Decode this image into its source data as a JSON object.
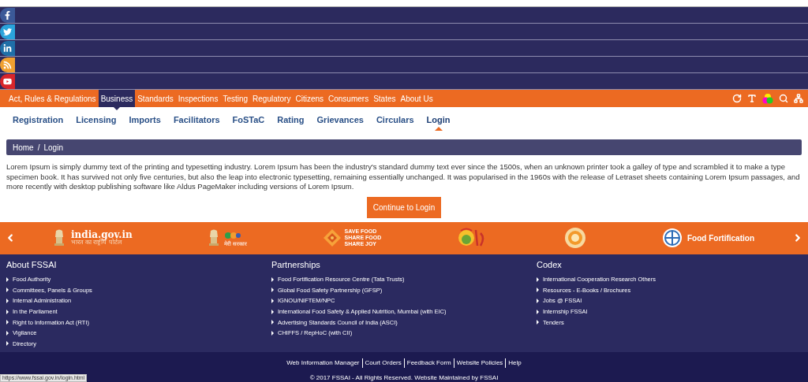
{
  "social_links": [
    {
      "kind": "facebook"
    },
    {
      "kind": "twitter"
    },
    {
      "kind": "linkedin"
    },
    {
      "kind": "rss"
    },
    {
      "kind": "youtube"
    }
  ],
  "main_nav": [
    {
      "label": "Act, Rules & Regulations",
      "selected": false
    },
    {
      "label": "Business",
      "selected": true
    },
    {
      "label": "Standards",
      "selected": false
    },
    {
      "label": "Inspections",
      "selected": false
    },
    {
      "label": "Testing",
      "selected": false
    },
    {
      "label": "Regulatory",
      "selected": false
    },
    {
      "label": "Citizens",
      "selected": false
    },
    {
      "label": "Consumers",
      "selected": false
    },
    {
      "label": "States",
      "selected": false
    },
    {
      "label": "About Us",
      "selected": false
    }
  ],
  "tools": [
    {
      "kind": "refresh"
    },
    {
      "kind": "text-size"
    },
    {
      "kind": "contrast"
    },
    {
      "kind": "search"
    },
    {
      "kind": "sitemap"
    }
  ],
  "sub_nav": [
    {
      "label": "Registration",
      "selected": false
    },
    {
      "label": "Licensing",
      "selected": false
    },
    {
      "label": "Imports",
      "selected": false
    },
    {
      "label": "Facilitators",
      "selected": false
    },
    {
      "label": "FoSTaC",
      "selected": false
    },
    {
      "label": "Rating",
      "selected": false
    },
    {
      "label": "Grievances",
      "selected": false
    },
    {
      "label": "Circulars",
      "selected": false
    },
    {
      "label": "Login",
      "selected": true
    }
  ],
  "breadcrumb": [
    "Home",
    "/",
    "Login"
  ],
  "intro": "Lorem Ipsum is simply dummy text of the printing and typesetting industry. Lorem Ipsum has been the industry's standard dummy text ever since the 1500s, when an unknown printer took a galley of type and scrambled it to make a type specimen book. It has survived not only five centuries, but also the leap into electronic typesetting, remaining essentially unchanged. It was popularised in the 1960s with the release of Letraset sheets containing Lorem Ipsum passages, and more recently with desktop publishing software like Aldus PageMaker including versions of Lorem Ipsum.",
  "continue_button": "Continue to Login",
  "carousel": [
    {
      "kind": "india-portal",
      "title": "india.gov.in",
      "subtitle": "भारत का राष्ट्रीय पोर्टल"
    },
    {
      "kind": "mygov",
      "subtitle": "मेरी सरकार"
    },
    {
      "kind": "save-food",
      "lines": [
        "SAVE FOOD",
        "SHARE FOOD",
        "SHARE JOY"
      ]
    },
    {
      "kind": "diet"
    },
    {
      "kind": "seal"
    },
    {
      "kind": "fortification",
      "title": "Food Fortification"
    }
  ],
  "footer_columns": [
    {
      "heading": "About FSSAI",
      "links": [
        "Food Authority",
        "Committees, Panels & Groups",
        "Internal Administration",
        "In the Parliament",
        "Right to Information Act (RTI)",
        "Vigilance",
        "Directory"
      ]
    },
    {
      "heading": "Partnerships",
      "links": [
        "Food Fortification Resource Centre (Tata Trusts)",
        "Global Food Safety Partnership (GFSP)",
        "IGNOU/NIFTEM/NPC",
        "International Food Safety & Applied Nutrition, Mumbai (with EIC)",
        "Advertising Standards Council of India (ASCI)",
        "CHIFFS / RepHoC (with CII)"
      ]
    },
    {
      "heading": "Codex",
      "links": [
        "International Cooperation Research Others",
        "Resources - E-Books / Brochures",
        "Jobs @ FSSAI",
        "Internship FSSAI",
        "Tenders"
      ]
    }
  ],
  "bottom_links": [
    "Web Information Manager",
    "Court Orders",
    "Feedback Form",
    "Website Policies",
    "Help"
  ],
  "copyright": "© 2017 FSSAI - All Rights Reserved. Website Maintained by FSSAI",
  "status_url": "https://www.fssai.gov.in/login.html"
}
